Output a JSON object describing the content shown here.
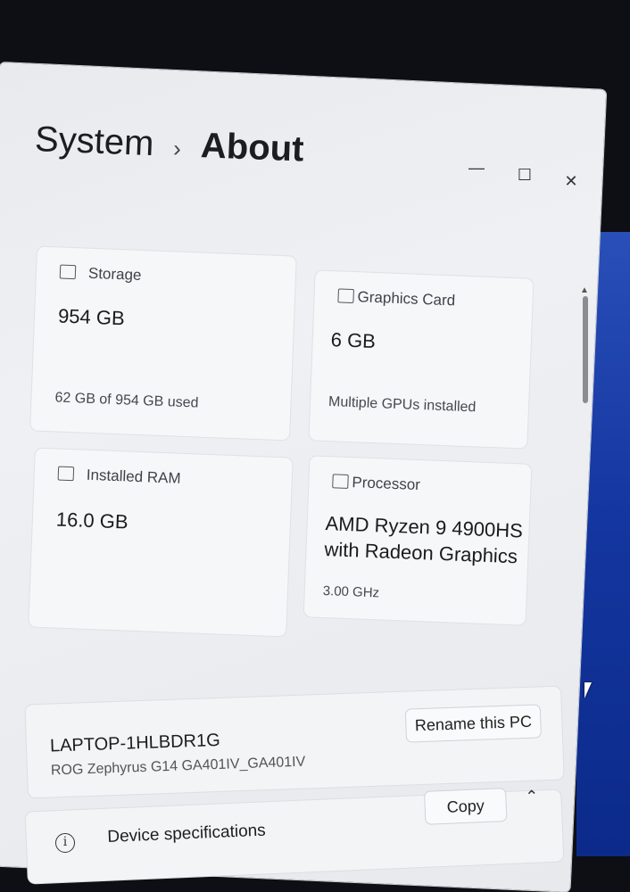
{
  "window": {
    "minimize_glyph": "—",
    "maximize_glyph": "☐",
    "close_glyph": "✕"
  },
  "breadcrumb": {
    "parent": "System",
    "separator": "›",
    "current": "About"
  },
  "cards": {
    "storage": {
      "title": "Storage",
      "value": "954 GB",
      "detail": "62 GB of 954 GB used",
      "icon": "storage-icon"
    },
    "graphics": {
      "title": "Graphics Card",
      "value": "6 GB",
      "detail": "Multiple GPUs installed",
      "icon": "graphics-card-icon"
    },
    "ram": {
      "title": "Installed RAM",
      "value": "16.0 GB",
      "icon": "ram-icon"
    },
    "processor": {
      "title": "Processor",
      "value_line1": "AMD Ryzen 9 4900HS",
      "value_line2": "with Radeon Graphics",
      "detail": "3.00 GHz",
      "icon": "processor-icon"
    }
  },
  "device": {
    "name": "LAPTOP-1HLBDR1G",
    "model": "ROG Zephyrus G14 GA401IV_GA401IV",
    "rename_label": "Rename this PC"
  },
  "specs": {
    "info_glyph": "i",
    "label": "Device specifications",
    "copy_label": "Copy",
    "collapse_glyph": "⌃"
  },
  "scrollbar": {
    "up_glyph": "▲"
  }
}
